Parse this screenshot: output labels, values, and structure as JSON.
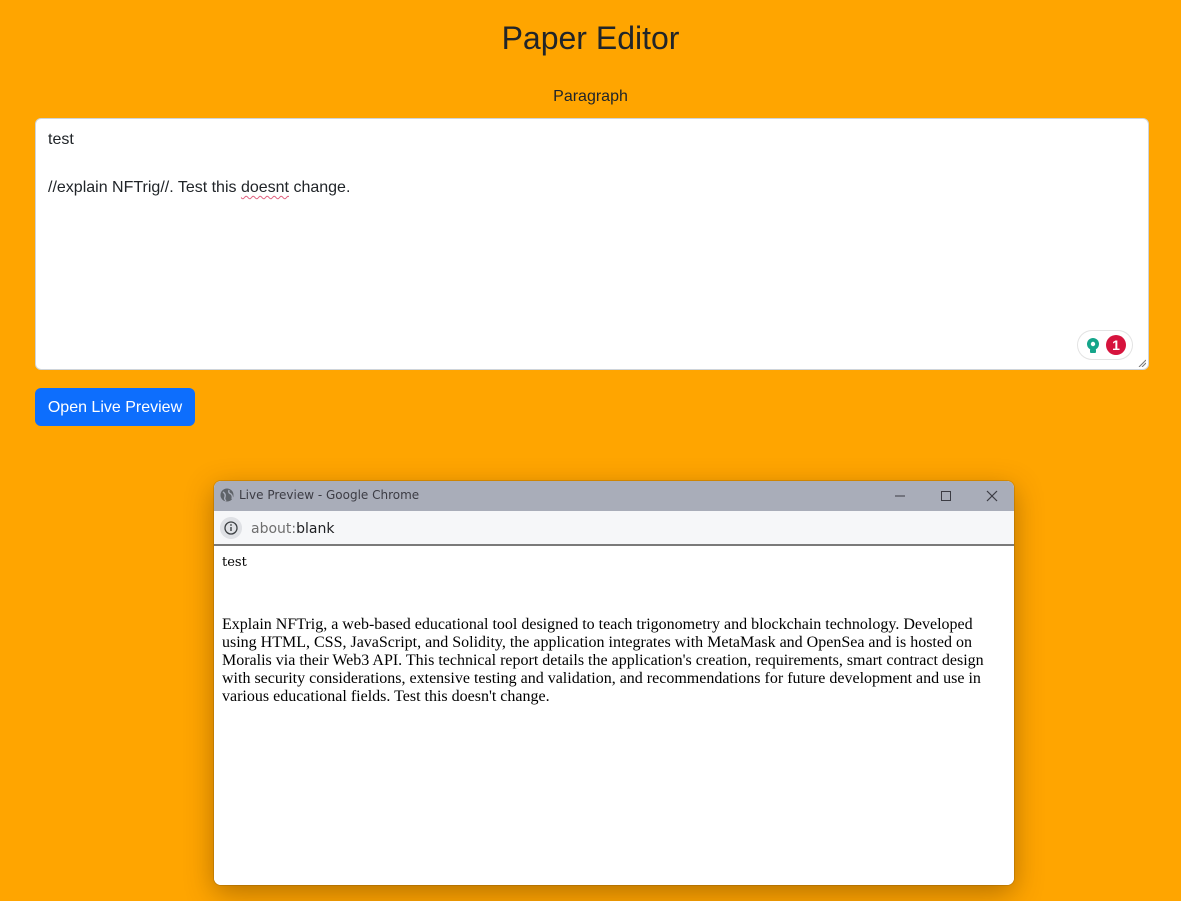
{
  "header": {
    "title": "Paper Editor"
  },
  "editor": {
    "label": "Paragraph",
    "line1": "test",
    "line2_before": "//explain NFTrig//. Test this ",
    "line2_misspelled": "doesnt",
    "line2_after": " change."
  },
  "grammarly": {
    "count": "1",
    "icon": "lightbulb-icon"
  },
  "buttons": {
    "open_preview": "Open Live Preview"
  },
  "colors": {
    "background": "#FFA500",
    "button": "#0d6efd",
    "badge": "#d6133d"
  },
  "popup": {
    "window_title": "Live Preview - Google Chrome",
    "url_scheme": "about:",
    "url_path": "blank",
    "preview_title": "test",
    "preview_text": "Explain NFTrig, a web-based educational tool designed to teach trigonometry and blockchain technology. Developed using HTML, CSS, JavaScript, and Solidity, the application integrates with MetaMask and OpenSea and is hosted on Moralis via their Web3 API. This technical report details the application's creation, requirements, smart contract design with security considerations, extensive testing and validation, and recommendations for future development and use in various educational fields. Test this doesn't change."
  }
}
